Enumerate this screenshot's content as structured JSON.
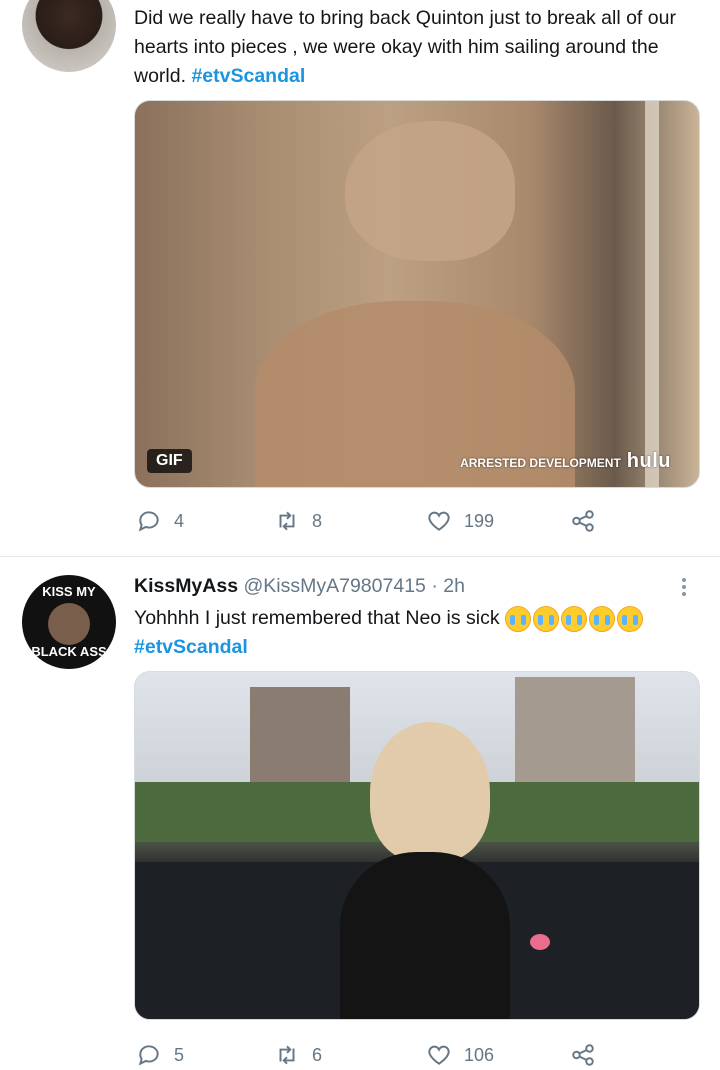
{
  "tweets": [
    {
      "text": "Did we really have to bring back Quinton just to break all of our hearts into pieces , we were okay with him sailing around the world.",
      "hashtag": "#etvScandal",
      "media": {
        "badge": "GIF",
        "watermark_a": "ARRESTED DEVELOPMENT",
        "watermark_b": "hulu"
      },
      "actions": {
        "replies": "4",
        "retweets": "8",
        "likes": "199"
      }
    },
    {
      "name": "KissMyAss",
      "handle": "@KissMyA79807415",
      "time": "· 2h",
      "avatar_top": "KISS MY",
      "avatar_bottom": "BLACK ASS",
      "text": "Yohhhh I just remembered that Neo is sick",
      "emoji": "loudly-crying-face x5",
      "hashtag": "#etvScandal",
      "actions": {
        "replies": "5",
        "retweets": "6",
        "likes": "106"
      }
    }
  ],
  "colors": {
    "accent": "#1b95e0",
    "muted": "#657786",
    "divider": "#e1e8ed"
  }
}
